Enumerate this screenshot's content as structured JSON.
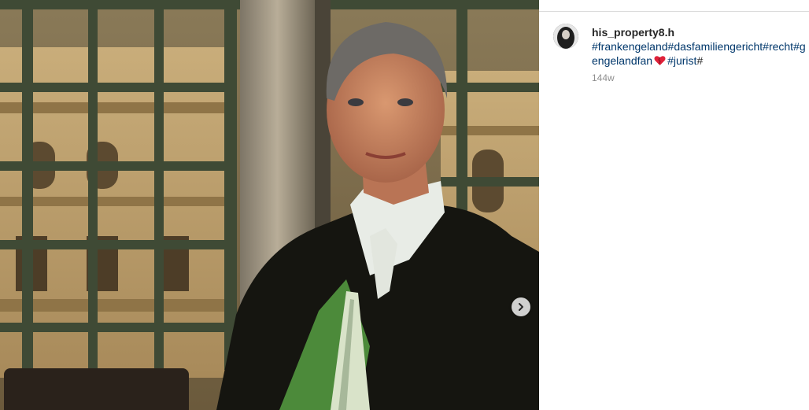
{
  "post": {
    "username": "his_property8.h",
    "caption_line1": [
      "#frankengeland",
      "#dasfamiliengericht",
      "#recht",
      "#g"
    ],
    "caption_line2": {
      "tag_start": "engelandfan",
      "emoji": "heart-emoji",
      "tag_end": "#jurist",
      "trailing": "#"
    },
    "timestamp": "144w"
  },
  "carousel": {
    "next_icon": "chevron-right-icon"
  },
  "colors": {
    "link": "#00376b",
    "text": "#262626",
    "muted": "#8e8e8e",
    "divider": "#dbdbdb"
  }
}
